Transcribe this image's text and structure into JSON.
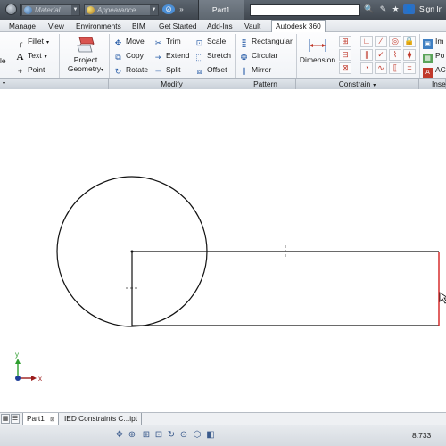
{
  "title_bar": {
    "material_placeholder": "Material",
    "appearance_placeholder": "Appearance",
    "document_title": "Part1",
    "sign_in": "Sign In"
  },
  "menu_tabs": [
    "Manage",
    "View",
    "Environments",
    "BIM",
    "Get Started",
    "Add-Ins",
    "Vault",
    "Autodesk 360"
  ],
  "ribbon": {
    "left_cut": "le",
    "fillet": "Fillet",
    "text": "Text",
    "point": "Point",
    "project_geometry_line1": "Project",
    "project_geometry_line2": "Geometry",
    "move": "Move",
    "copy": "Copy",
    "rotate": "Rotate",
    "trim": "Trim",
    "extend": "Extend",
    "split": "Split",
    "scale": "Scale",
    "stretch": "Stretch",
    "offset": "Offset",
    "rectangular": "Rectangular",
    "circular": "Circular",
    "mirror": "Mirror",
    "dimension": "Dimension",
    "insert_image": "Im",
    "insert_points": "Po",
    "insert_acad": "AC",
    "panels": {
      "modify": "Modify",
      "pattern": "Pattern",
      "constrain": "Constrain",
      "insert": "Inse"
    }
  },
  "axis": {
    "x": "x",
    "y": "y"
  },
  "bottom_tabs": [
    "Part1",
    "IED Constraints C...ipt"
  ],
  "status": {
    "coordinate": "8.733 i"
  },
  "colors": {
    "accent_red": "#d42020",
    "axis_green": "#2e9e2e",
    "axis_blue": "#1f3f9a"
  }
}
